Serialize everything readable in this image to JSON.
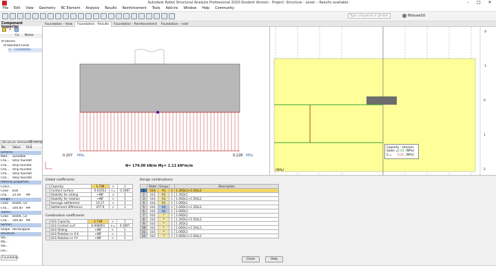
{
  "window": {
    "title": "Autodesk Robot Structural Analysis Professional 2020-Student Version - Project: Structure - Level: - Results available"
  },
  "menu": [
    "File",
    "Edit",
    "View",
    "Geometry",
    "RC Element",
    "Analysis",
    "Results",
    "Reinforcement",
    "Tools",
    "Add-ins",
    "Window",
    "Help",
    "Community"
  ],
  "toolbar": {
    "search_placeholder": "Type a keyword or phrase",
    "user": "Nhouse10"
  },
  "tabs": [
    "Foundation - View",
    "Foundation - Results",
    "Foundation - Reinforcement",
    "Foundation - note"
  ],
  "inspector": {
    "title": "Component Inspector",
    "tree_headers": [
      "Ca",
      "Name"
    ],
    "tree_items": [
      "Stories",
      "Standard Level",
      "Foundation"
    ],
    "tab_elements": "Structure elements",
    "tab_drawings": "Drawings",
    "props_headers": [
      "Na",
      "Value",
      "Unit"
    ],
    "props_rows": [
      {
        "name": "General",
        "value": "",
        "unit": "",
        "section": true
      },
      {
        "name": "Mod...",
        "value": "available",
        "unit": ""
      },
      {
        "name": "Cho...",
        "value": "Strip foundat",
        "unit": ""
      },
      {
        "name": "Cho...",
        "value": "strip foundat",
        "unit": ""
      },
      {
        "name": "Cho...",
        "value": "strip foundat",
        "unit": ""
      },
      {
        "name": "Cho...",
        "value": "Strip foundat",
        "unit": ""
      },
      {
        "name": "Cho...",
        "value": "Strip foundat",
        "unit": ""
      },
      {
        "name": "Material properties",
        "value": "",
        "unit": "",
        "section": true
      },
      {
        "name": "Concr...",
        "value": "",
        "unit": ""
      },
      {
        "name": "Class",
        "value": "B30",
        "unit": ""
      },
      {
        "name": "Cha...",
        "value": "25.00",
        "unit": "MP"
      },
      {
        "name": "Longit...",
        "value": "",
        "unit": "",
        "section": true
      },
      {
        "name": "Class",
        "value": "B500C (2)",
        "unit": ""
      },
      {
        "name": "Cha...",
        "value": "500.00",
        "unit": "MP"
      },
      {
        "name": "Transv...",
        "value": "",
        "unit": "",
        "section": true
      },
      {
        "name": "Class",
        "value": "B500C (2)",
        "unit": ""
      },
      {
        "name": "Cha...",
        "value": "500.00",
        "unit": "MP"
      },
      {
        "name": "Section",
        "value": "",
        "unit": "",
        "section": true
      },
      {
        "name": "Shape",
        "value": "Rectangular",
        "unit": ""
      },
      {
        "name": "Structure",
        "value": "",
        "unit": "",
        "section": true
      },
      {
        "name": "Sto...",
        "value": "",
        "unit": ""
      },
      {
        "name": "Wa...",
        "value": "",
        "unit": ""
      },
      {
        "name": "Sto...",
        "value": "",
        "unit": ""
      },
      {
        "name": "Lev...",
        "value": "",
        "unit": ""
      }
    ],
    "bottom_tab": "Foundation"
  },
  "view1": {
    "left_pressure": "0.207",
    "right_pressure": "0.228",
    "unit": "MPa",
    "forces": "N= 174.00 kN/m   My= 1.11 kN*m/m"
  },
  "view2": {
    "scale_labels": [
      "-2",
      "-1",
      "0",
      "1",
      "2"
    ],
    "mpa_label": "[MPa]",
    "tooltip": {
      "title": "Capacity - stresses",
      "line1_label": "Sadm =",
      "line1_value": "0.40",
      "line1_unit": "[MPa]",
      "line2_label": "S =",
      "line2_value": "0.25",
      "line2_unit": "[MPa]"
    }
  },
  "dialog": {
    "global_title": "Global coefficients:",
    "global_rows": [
      {
        "name": "Capacity",
        "value": "1.739",
        "op": ">",
        "limit": "1",
        "highlight": true
      },
      {
        "name": "Contact surface",
        "value": "0.01653",
        "op": "<=",
        "limit": "0.1667"
      },
      {
        "name": "Stability for sliding",
        "value": "+INF",
        "op": ">",
        "limit": "1"
      },
      {
        "name": "Stability for rotation",
        "value": "+INF",
        "op": ">",
        "limit": "1"
      },
      {
        "name": "Average settlement",
        "value": "10.27",
        "op": "<",
        "limit": "1"
      },
      {
        "name": "Settlement difference",
        "value": "477.9",
        "op": ">",
        "limit": "1"
      }
    ],
    "comb_title": "Combination coefficients:",
    "comb_rows": [
      {
        "name": "ULS Capacity",
        "value": "1.739",
        "op": ">",
        "limit": "1",
        "highlight": true
      },
      {
        "name": "ULS Contact surf",
        "value": "0.000061",
        "op": "<=",
        "limit": "0.1667"
      },
      {
        "name": "ULS Sliding",
        "value": "+INF",
        "op": ">",
        "limit": "1"
      },
      {
        "name": "ULS Rotation in X-X",
        "value": "+INF",
        "op": ">",
        "limit": "1"
      },
      {
        "name": "ULS Rotation in Y-Y",
        "value": "+INF",
        "op": ">",
        "limit": "1"
      }
    ],
    "design_title": "Design combinations:",
    "design_headers": [
      "",
      "State",
      "Group",
      "",
      "Description"
    ],
    "design_rows": [
      {
        "n": "1",
        "state": "ULS",
        "group": "A1",
        "c": "1",
        "desc": "1.35DL1+1.50LL1",
        "selected": true
      },
      {
        "n": "2",
        "state": "ULS",
        "group": "A1",
        "c": "1",
        "desc": "1.35DL1"
      },
      {
        "n": "3",
        "state": "ULS",
        "group": "A1",
        "c": "1",
        "desc": "1.00DL1+1.50LL1"
      },
      {
        "n": "4",
        "state": "ULS",
        "group": "A1",
        "c": "1",
        "desc": "1.00DL1"
      },
      {
        "n": "5",
        "state": "ULS",
        "group": "A2",
        "c": "1",
        "desc": "1.00DL1+1.30LL1"
      },
      {
        "n": "6",
        "state": "ULS",
        "group": "A2",
        "c": "1",
        "desc": "1.00DL1"
      },
      {
        "n": "7",
        "state": "ULS",
        "group": "*",
        "c": "1",
        "desc": "1.00DL1"
      },
      {
        "n": "8",
        "state": "ULS",
        "group": "*",
        "c": "1",
        "desc": "1.35DL1+1.50LL1"
      },
      {
        "n": "9",
        "state": "ULS",
        "group": "*",
        "c": "1",
        "desc": "1.35DL1"
      },
      {
        "n": "10",
        "state": "ULS",
        "group": "*",
        "c": "1",
        "desc": "1.00DL1+1.50LL1"
      },
      {
        "n": "11",
        "state": "ULS",
        "group": "*",
        "c": "1",
        "desc": "1.00DL1"
      },
      {
        "n": "12",
        "state": "ULS",
        "group": "*",
        "c": "1",
        "desc": "1.00DL1+1.00LL1"
      }
    ],
    "close_label": "Close",
    "help_label": "Help"
  },
  "colors": {
    "accent": "#3c6db0",
    "highlight": "#f4d56a",
    "plot_bg": "#ffff99",
    "pressure": "#c2373b"
  }
}
